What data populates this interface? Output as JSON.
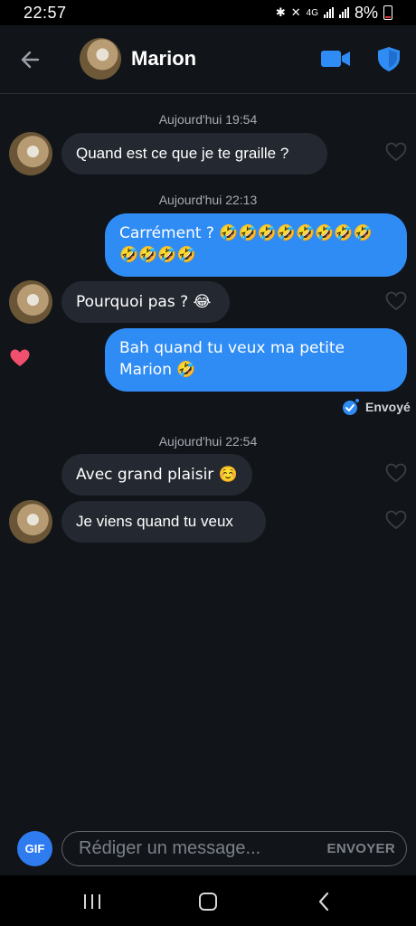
{
  "status_bar": {
    "time": "22:57",
    "network": "4G",
    "battery": "8%"
  },
  "header": {
    "contact_name": "Marion",
    "icons": [
      "back-arrow-icon",
      "video-camera-icon",
      "shield-icon"
    ],
    "accent_color": "#2f8cf4"
  },
  "messages": {
    "ts1": "Aujourd'hui 19:54",
    "m1": "Quand est ce que je te graille ?",
    "ts2": "Aujourd'hui 22:13",
    "m2_line1": "Carrément ? 🤣🤣🤣🤣🤣🤣🤣🤣",
    "m2_line2": "🤣🤣🤣🤣",
    "m3": "Pourquoi pas ? 😂",
    "m4_line1": "Bah quand tu veux ma petite",
    "m4_line2": "Marion 🤣",
    "sent_status": "Envoyé",
    "ts3": "Aujourd'hui 22:54",
    "m5": "Avec grand plaisir ☺️",
    "m6": "Je viens quand tu veux"
  },
  "composer": {
    "gif_label": "GIF",
    "placeholder": "Rédiger un message...",
    "send_label": "ENVOYER"
  },
  "colors": {
    "background": "#111418",
    "incoming_bubble": "#242830",
    "outgoing_bubble": "#2f8cf4",
    "like_heart": "#f0506e"
  }
}
